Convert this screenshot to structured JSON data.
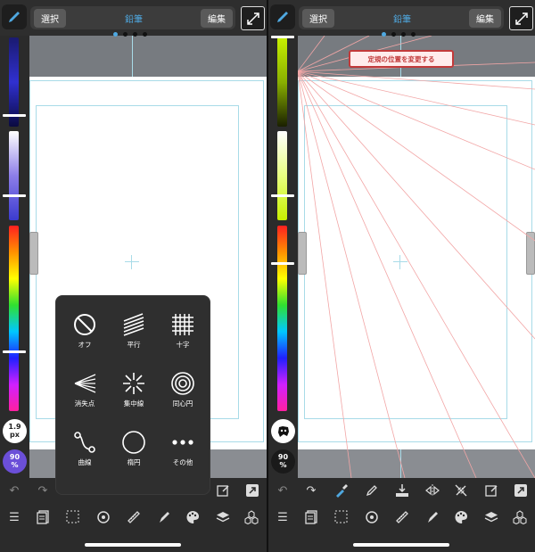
{
  "left": {
    "select_label": "選択",
    "tool_name": "鉛筆",
    "edit_label": "編集",
    "brush_size": "1.9",
    "brush_size_unit": "px",
    "opacity": "90",
    "opacity_unit": "%",
    "ruler_menu": {
      "items": [
        {
          "label": "オフ",
          "icon": "prohibit-icon"
        },
        {
          "label": "平行",
          "icon": "parallel-icon"
        },
        {
          "label": "十字",
          "icon": "cross-grid-icon"
        },
        {
          "label": "消失点",
          "icon": "vanishing-point-icon"
        },
        {
          "label": "集中線",
          "icon": "concentrated-lines-icon"
        },
        {
          "label": "同心円",
          "icon": "concentric-circle-icon"
        },
        {
          "label": "曲線",
          "icon": "curve-icon"
        },
        {
          "label": "楕円",
          "icon": "ellipse-icon"
        },
        {
          "label": "その他",
          "icon": "more-icon"
        }
      ]
    }
  },
  "right": {
    "select_label": "選択",
    "tool_name": "鉛筆",
    "edit_label": "編集",
    "change_ruler_position": "定規の位置を変更する",
    "opacity": "90",
    "opacity_unit": "%"
  },
  "colors": {
    "accent": "#4fa8e0",
    "ruler_red": "#c23a3a",
    "left_color_swatch": "#6b4fd8",
    "right_color": "#c8f000"
  },
  "toolbar_icons": {
    "row1": [
      "undo-icon",
      "redo-icon",
      "eyedropper-icon",
      "pen-icon",
      "fill-icon",
      "symmetry-icon",
      "ruler-snap-icon",
      "clear-icon",
      "transform-icon"
    ],
    "row2": [
      "menu-icon",
      "pages-icon",
      "selection-icon",
      "rotate-icon",
      "ruler-icon",
      "brush-icon",
      "palette-icon",
      "layers-icon",
      "material-icon"
    ]
  }
}
